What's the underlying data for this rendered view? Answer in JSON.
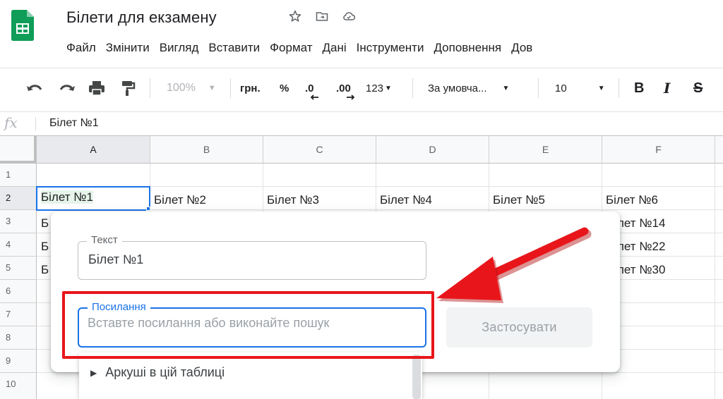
{
  "document": {
    "title": "Білети для екзамену"
  },
  "menu": [
    "Файл",
    "Змінити",
    "Вигляд",
    "Вставити",
    "Формат",
    "Дані",
    "Інструменти",
    "Доповнення",
    "Дов"
  ],
  "toolbar": {
    "zoom": "100%",
    "currency": "грн.",
    "percent": "%",
    "decrease_decimals": ".0",
    "increase_decimals": ".00",
    "number_format": "123",
    "font": "За умовча...",
    "font_size": "10",
    "bold": "B",
    "italic": "I",
    "strike": "S"
  },
  "formula_bar": {
    "fx": "fx",
    "value": "Білет №1"
  },
  "grid": {
    "columns": [
      "A",
      "B",
      "C",
      "D",
      "E",
      "F"
    ],
    "rows": [
      "1",
      "2",
      "3",
      "4",
      "5",
      "6",
      "7",
      "8",
      "9",
      "10"
    ],
    "row2": [
      "Білет №1",
      "Білет №2",
      "Білет №3",
      "Білет №4",
      "Білет №5",
      "Білет №6"
    ],
    "col_a_partial": [
      "Б",
      "Б",
      "Б"
    ],
    "col_f_partial": [
      "лет №14",
      "лет №22",
      "лет №30"
    ]
  },
  "link_popup": {
    "text_label": "Текст",
    "text_value": "Білет №1",
    "link_label": "Посилання",
    "link_placeholder": "Вставте посилання або виконайте пошук",
    "apply_label": "Застосувати",
    "sheets_item": "Аркуші в цій таблиці"
  },
  "colors": {
    "accent_blue": "#1a73e8",
    "sheets_green": "#0f9d58",
    "annotation_red": "#e8161b",
    "active_cell_fill": "#e6f4ea"
  }
}
